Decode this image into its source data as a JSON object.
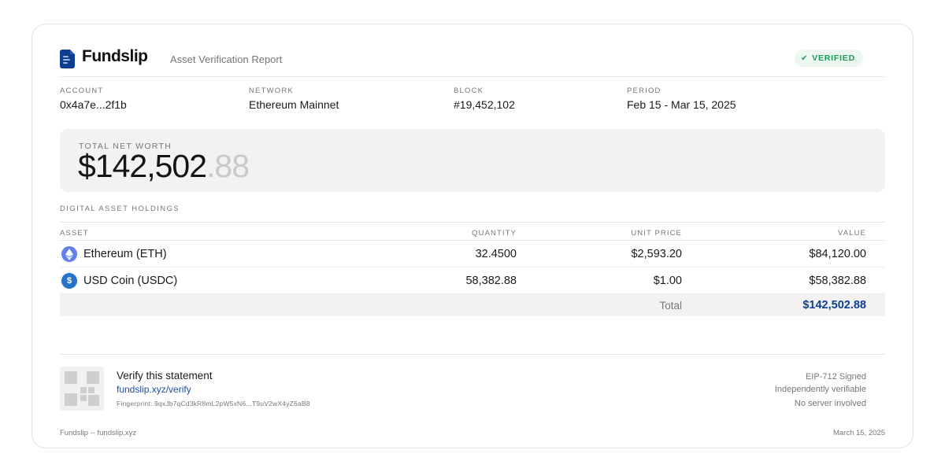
{
  "header": {
    "brand": "Fundslip",
    "report_title": "Asset Verification Report",
    "badge": "VERIFIED"
  },
  "meta": [
    {
      "label": "ACCOUNT",
      "value": "0x4a7e...2f1b"
    },
    {
      "label": "NETWORK",
      "value": "Ethereum Mainnet"
    },
    {
      "label": "BLOCK",
      "value": "#19,452,102"
    },
    {
      "label": "PERIOD",
      "value": "Feb 15 - Mar 15, 2025"
    }
  ],
  "net_worth": {
    "label": "TOTAL NET WORTH",
    "whole": "$142,502",
    "cents": ".88"
  },
  "holdings": {
    "section_title": "DIGITAL ASSET HOLDINGS",
    "columns": [
      "ASSET",
      "QUANTITY",
      "UNIT PRICE",
      "VALUE"
    ],
    "rows": [
      {
        "icon": "ethereum-icon",
        "asset": "Ethereum (ETH)",
        "quantity": "32.4500",
        "unit_price": "$2,593.20",
        "value": "$84,120.00"
      },
      {
        "icon": "usdc-icon",
        "asset": "USD Coin (USDC)",
        "quantity": "58,382.88",
        "unit_price": "$1.00",
        "value": "$58,382.88"
      }
    ],
    "total_label": "Total",
    "total_value": "$142,502.88"
  },
  "verify": {
    "title": "Verify this statement",
    "link": "fundslip.xyz/verify",
    "fingerprint": "Fingerprint: 9qxJb7qCd3kR8mL2pW5xN6...T9uV2wX4yZ6aB8",
    "signatures": [
      "EIP-712 Signed",
      "Independently verifiable",
      "No server involved"
    ]
  },
  "footer": {
    "left": "Fundslip -- fundslip.xyz",
    "right": "March 15, 2025"
  },
  "colors": {
    "brand": "#0f3d8f",
    "verified": "#1a9a56",
    "eth": "#627eea",
    "usdc": "#2775ca"
  }
}
